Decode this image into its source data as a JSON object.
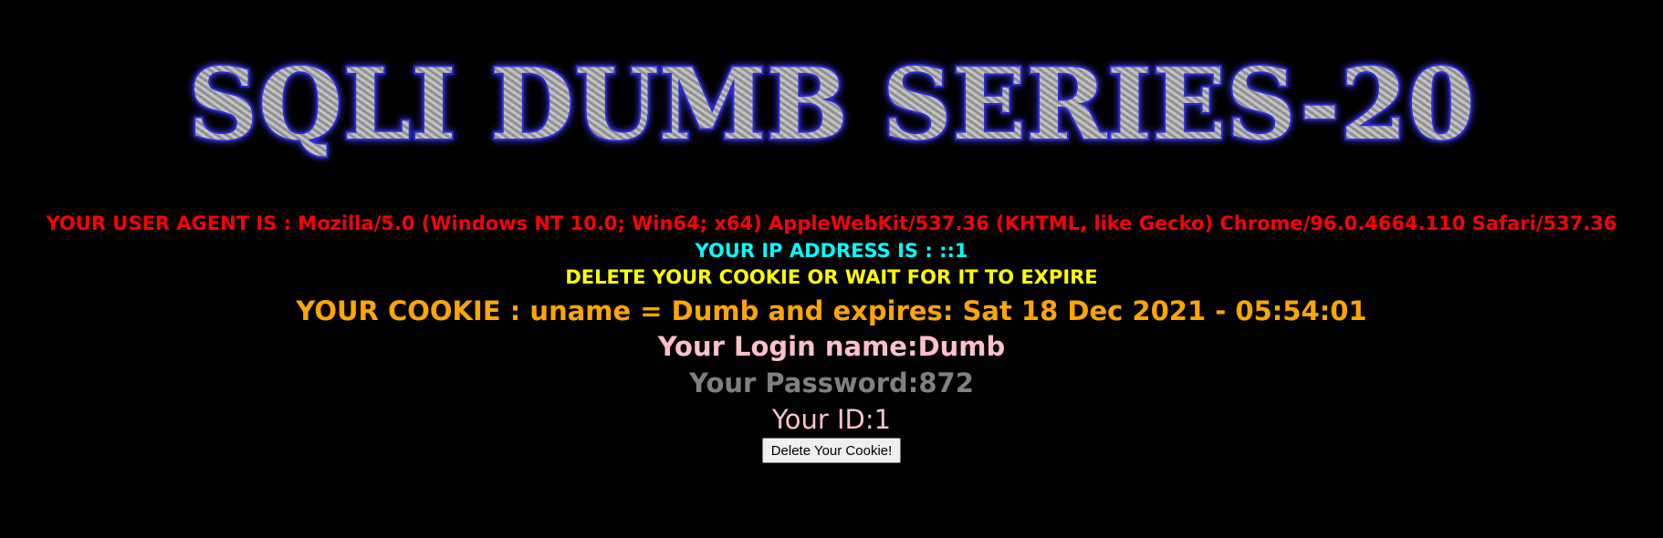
{
  "banner": {
    "title": "SQLI DUMB SERIES-20"
  },
  "info": {
    "user_agent": "YOUR USER AGENT IS : Mozilla/5.0 (Windows NT 10.0; Win64; x64) AppleWebKit/537.36 (KHTML, like Gecko) Chrome/96.0.4664.110 Safari/537.36",
    "ip_address": "YOUR IP ADDRESS IS : ::1",
    "delete_message": "DELETE YOUR COOKIE OR WAIT FOR IT TO EXPIRE",
    "cookie": "YOUR COOKIE : uname = Dumb and expires: Sat 18 Dec 2021 - 05:54:01",
    "login_name": "Your Login name:Dumb",
    "password": "Your Password:872",
    "id": "Your ID:1"
  },
  "form": {
    "delete_button_label": "Delete Your Cookie!"
  },
  "colors": {
    "background": "#000000",
    "user_agent": "#ff0000",
    "ip_address": "#00ffff",
    "delete_message": "#ffff00",
    "cookie": "#ffa500",
    "login_name": "#ffc0cb",
    "password": "#808080",
    "id": "#ffc0cb",
    "banner_outline": "#2a2ad8"
  }
}
